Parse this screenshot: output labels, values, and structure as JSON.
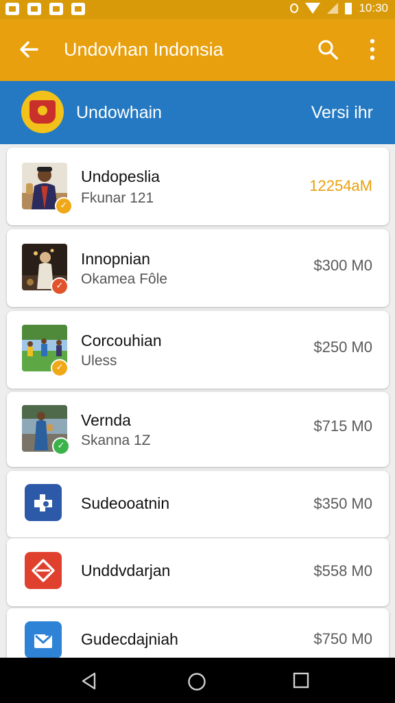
{
  "status_bar": {
    "time": "10:30"
  },
  "app_bar": {
    "title": "Undovhan Indonsia"
  },
  "sub_header": {
    "title": "Undowhain",
    "right_label": "Versi ihr"
  },
  "items": [
    {
      "title": "Undopeslia",
      "subtitle": "Fkunar 121",
      "price": "12254aM",
      "badge": "✓",
      "badge_color": "#f0a818",
      "accent": "#e8a00e"
    },
    {
      "title": "Innopnian",
      "subtitle": "Okamea Fôle",
      "price": "$300 M0",
      "badge": "✓",
      "badge_color": "#e0532b"
    },
    {
      "title": "Corcouhian",
      "subtitle": "Uless",
      "price": "$250 M0",
      "badge": "✓",
      "badge_color": "#f0a818"
    },
    {
      "title": "Vernda",
      "subtitle": "Skanna 1Z",
      "price": "$715 M0",
      "badge": "✓",
      "badge_color": "#3bb34a"
    },
    {
      "title": "Sudeooatnin",
      "price": "$350 M0"
    },
    {
      "title": "Unddvdarjan",
      "price": "$558 M0"
    },
    {
      "title": "Gudecdajniah",
      "price": "$750 M0"
    }
  ],
  "colors": {
    "status_bar": "#d99a0a",
    "app_bar": "#e8a00e",
    "sub_header": "#2479c2",
    "icon_blue": "#2c5aa8",
    "icon_red": "#e0412f",
    "icon_lightblue": "#2e83d6"
  }
}
